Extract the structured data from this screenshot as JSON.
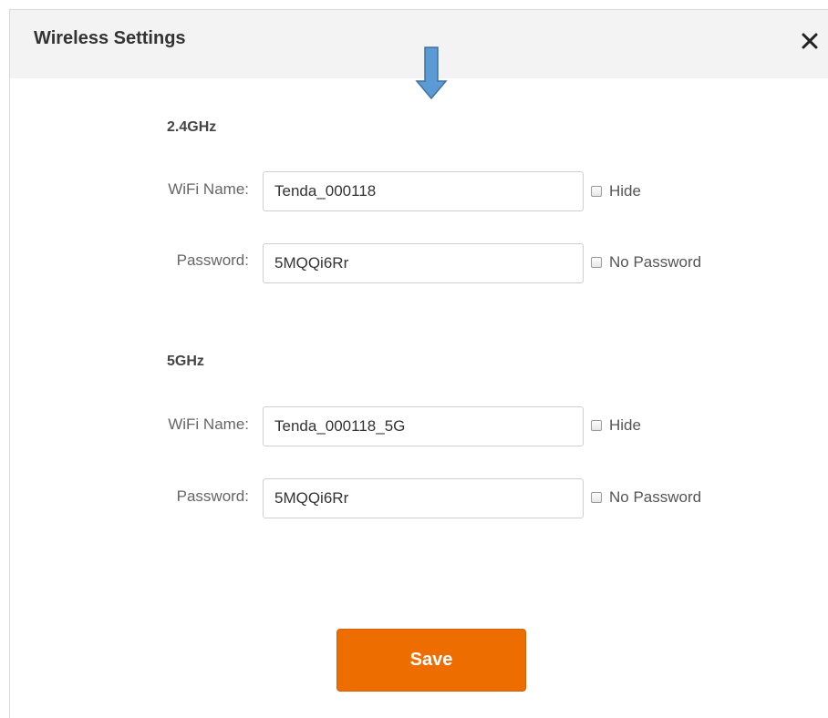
{
  "dialog": {
    "title": "Wireless Settings",
    "close_icon": "close-icon",
    "arrow_icon": "down-arrow-icon",
    "arrow_color": "#5b9bd5"
  },
  "band_24": {
    "label": "2.4GHz",
    "wifi_name_label": "WiFi Name:",
    "wifi_name_value": "Tenda_000118",
    "hide_label": "Hide",
    "password_label": "Password:",
    "password_value": "5MQQi6Rr",
    "no_password_label": "No Password"
  },
  "band_5": {
    "label": "5GHz",
    "wifi_name_label": "WiFi Name:",
    "wifi_name_value": "Tenda_000118_5G",
    "hide_label": "Hide",
    "password_label": "Password:",
    "password_value": "5MQQi6Rr",
    "no_password_label": "No Password"
  },
  "save_label": "Save",
  "colors": {
    "accent": "#ee6d00",
    "header_bg": "#f3f3f3"
  }
}
